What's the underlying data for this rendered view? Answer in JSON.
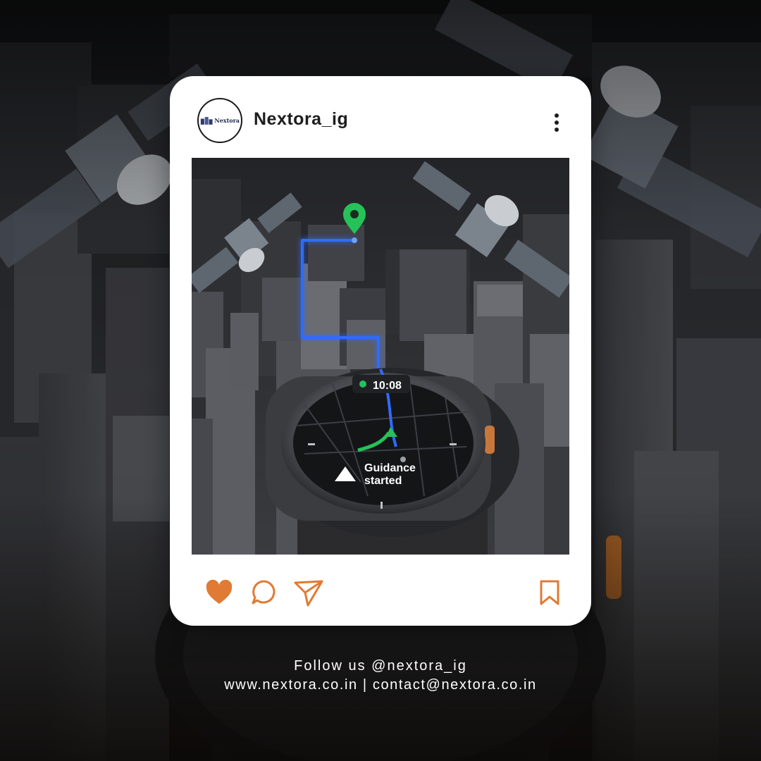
{
  "post": {
    "username": "Nextora_ig",
    "avatar": {
      "logo_text": "Nextora"
    },
    "image": {
      "watch_time": "10:08",
      "watch_message_line1": "Guidance",
      "watch_message_line2": "started"
    },
    "actions": {
      "like_icon": "heart-filled-icon",
      "comment_icon": "comment-bubble-icon",
      "share_icon": "paper-plane-icon",
      "save_icon": "bookmark-icon"
    }
  },
  "footer": {
    "follow_text": "Follow us @nextora_ig",
    "contact_text": "www.nextora.co.in | contact@nextora.co.in"
  },
  "colors": {
    "accent": "#e07a34",
    "route": "#2f6bff",
    "pin": "#25c25a",
    "card_bg": "#ffffff"
  }
}
